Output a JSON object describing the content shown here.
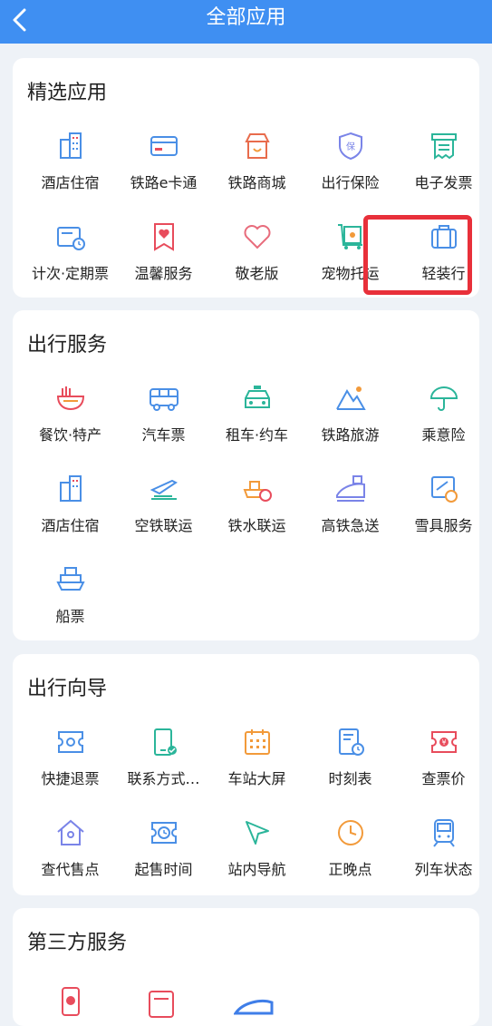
{
  "header": {
    "title": "全部应用",
    "back_icon": "back-arrow-icon"
  },
  "sections": [
    {
      "title": "精选应用",
      "items": [
        {
          "label": "酒店住宿",
          "icon": "hotel-building-icon"
        },
        {
          "label": "铁路e卡通",
          "icon": "card-icon"
        },
        {
          "label": "铁路商城",
          "icon": "shop-icon"
        },
        {
          "label": "出行保险",
          "icon": "shield-icon"
        },
        {
          "label": "电子发票",
          "icon": "receipt-icon"
        },
        {
          "label": "计次·定期票",
          "icon": "timed-ticket-icon"
        },
        {
          "label": "温馨服务",
          "icon": "heart-ribbon-icon"
        },
        {
          "label": "敬老版",
          "icon": "heart-outline-icon"
        },
        {
          "label": "宠物托运",
          "icon": "pet-cart-icon"
        },
        {
          "label": "轻装行",
          "icon": "suitcase-icon"
        }
      ]
    },
    {
      "title": "出行服务",
      "items": [
        {
          "label": "餐饮·特产",
          "icon": "noodle-bowl-icon"
        },
        {
          "label": "汽车票",
          "icon": "bus-icon"
        },
        {
          "label": "租车·约车",
          "icon": "taxi-icon"
        },
        {
          "label": "铁路旅游",
          "icon": "mountain-icon"
        },
        {
          "label": "乘意险",
          "icon": "umbrella-icon"
        },
        {
          "label": "酒店住宿",
          "icon": "hotel-building-icon"
        },
        {
          "label": "空铁联运",
          "icon": "plane-train-icon"
        },
        {
          "label": "铁水联运",
          "icon": "ship-train-icon"
        },
        {
          "label": "高铁急送",
          "icon": "express-train-icon"
        },
        {
          "label": "雪具服务",
          "icon": "ski-service-icon"
        },
        {
          "label": "船票",
          "icon": "ferry-icon"
        }
      ]
    },
    {
      "title": "出行向导",
      "items": [
        {
          "label": "快捷退票",
          "icon": "refund-ticket-icon"
        },
        {
          "label": "联系方式…",
          "icon": "phone-check-icon"
        },
        {
          "label": "车站大屏",
          "icon": "station-screen-icon"
        },
        {
          "label": "时刻表",
          "icon": "timetable-icon"
        },
        {
          "label": "查票价",
          "icon": "yen-ticket-icon"
        },
        {
          "label": "查代售点",
          "icon": "house-location-icon"
        },
        {
          "label": "起售时间",
          "icon": "sale-clock-icon"
        },
        {
          "label": "站内导航",
          "icon": "navigation-arrow-icon"
        },
        {
          "label": "正晚点",
          "icon": "clock-icon"
        },
        {
          "label": "列车状态",
          "icon": "train-status-icon"
        }
      ]
    },
    {
      "title": "第三方服务",
      "items": []
    }
  ],
  "colors": {
    "header": "#3f8ff2",
    "highlight_border": "#e8303a",
    "icon_blue": "#4a8fe6",
    "icon_red": "#e84c5c",
    "icon_green": "#2bb59a",
    "icon_orange": "#f29a3a"
  }
}
